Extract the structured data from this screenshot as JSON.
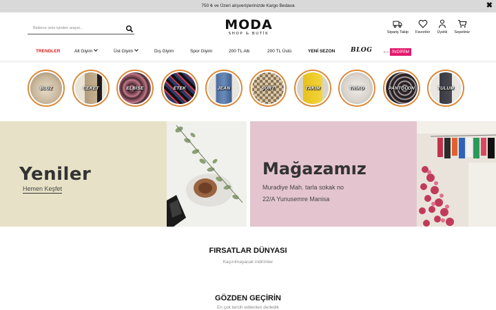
{
  "announcement": {
    "text": "750 ₺ ve Üzeri alışverişlerinizde Kargo Bedava",
    "close": "✖"
  },
  "search": {
    "placeholder": "Binlerce ürün içinden arayın...",
    "value": ""
  },
  "logo": {
    "main": "MODA",
    "sub": "SHOP & BUTİK"
  },
  "header_icons": [
    {
      "label": "Sipariş Takip",
      "icon": "truck-icon"
    },
    {
      "label": "Favoriler",
      "icon": "heart-icon"
    },
    {
      "label": "Üyelik",
      "icon": "user-icon"
    },
    {
      "label": "Sepetiniz",
      "icon": "cart-icon"
    }
  ],
  "nav": {
    "trendler": "TRENDLER",
    "alt_giyim": "Alt Giyim",
    "ust_giyim": "Üst Giyim",
    "dis_giyim": "Dış Giyim",
    "spor_giyim": "Spor Giyim",
    "alt200": "200 TL Altı",
    "ust200": "200 TL Üstü",
    "yeni_sezon": "YENİ SEZON",
    "blog": "BLOG",
    "indirim": "İNDİRİM"
  },
  "categories": [
    {
      "label": "BLUZ",
      "color": "#c9b79b"
    },
    {
      "label": "CEKET",
      "color": "#b9a78c"
    },
    {
      "label": "ELBİSE",
      "color": "#7a4a58"
    },
    {
      "label": "ETEK",
      "color": "#3b4a7a"
    },
    {
      "label": "JEAN",
      "color": "#5a78a8"
    },
    {
      "label": "ŞORT",
      "color": "#d9c8a8"
    },
    {
      "label": "TAKIM",
      "color": "#e7c21f"
    },
    {
      "label": "TRİKO",
      "color": "#d8d3cc"
    },
    {
      "label": "PANTOLON",
      "color": "#3a2e33"
    },
    {
      "label": "TULUM",
      "color": "#4a4a52"
    }
  ],
  "banners": {
    "new": {
      "title": "Yeniler",
      "cta": "Hemen Keşfet"
    },
    "store": {
      "title": "Mağazamız",
      "address_line1": "Muradiye Mah. tarla sokak no",
      "address_line2": "22/A Yunusemre Manisa"
    }
  },
  "sections": {
    "deals": {
      "title": "FIRSATLAR DÜNYASI",
      "subtitle": "Kaçırılmayacak indirimler"
    },
    "browse": {
      "title": "GÖZDEN GEÇİRİN",
      "subtitle": "En çok tercih edilenleri derledik"
    }
  },
  "colors": {
    "accent_red": "#d41f1f",
    "indirim_pink": "#e3196e",
    "ring_orange": "#d98a3c",
    "banner1_bg": "#e7e2c7",
    "banner2_bg": "#e4c5cf"
  }
}
